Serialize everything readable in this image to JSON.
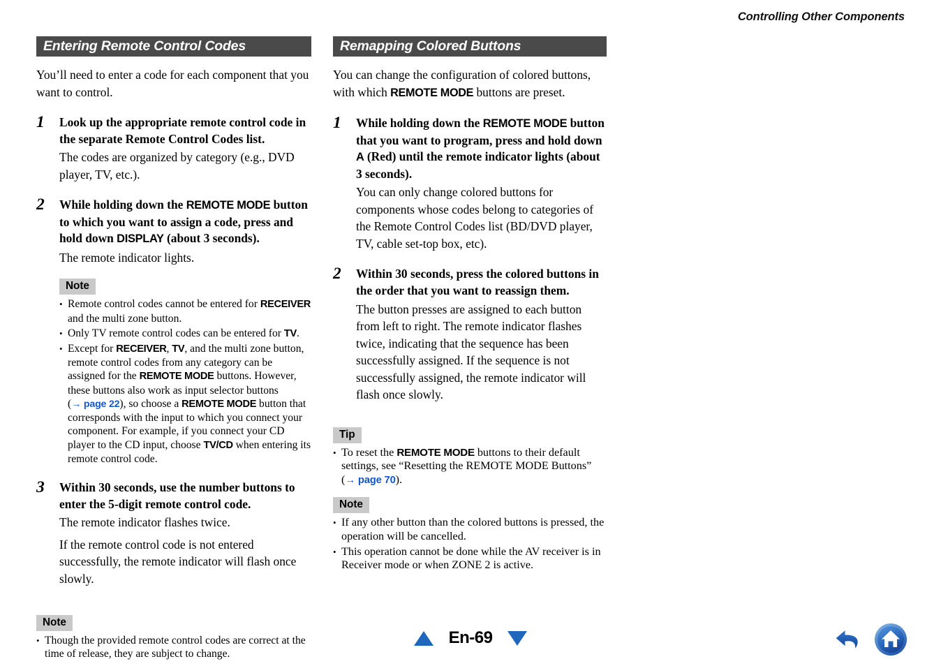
{
  "running_head": "Controlling Other Components",
  "colors": {
    "section_bar_bg": "#4a4a4a",
    "badge_bg": "#c9c9c9",
    "link_blue": "#1357cc",
    "nav_blue": "#1f66bd"
  },
  "left_column": {
    "section_title": "Entering Remote Control Codes",
    "intro": "You’ll need to enter a code for each component that you want to control.",
    "steps": [
      {
        "number": "1",
        "title_parts": [
          {
            "text": "Look up the appropriate remote control code in the separate Remote Control Codes list.",
            "style": "serif-bold"
          }
        ],
        "body": [
          "The codes are organized by category (e.g., DVD player, TV, etc.)."
        ]
      },
      {
        "number": "2",
        "title_parts": [
          {
            "text": "While holding down the ",
            "style": "serif-bold"
          },
          {
            "text": "REMOTE MODE",
            "style": "key"
          },
          {
            "text": " button to which you want to assign a code, press and hold down ",
            "style": "serif-bold"
          },
          {
            "text": "DISPLAY",
            "style": "key"
          },
          {
            "text": " (about 3 seconds).",
            "style": "serif-bold"
          }
        ],
        "body": [
          "The remote indicator lights."
        ],
        "note": {
          "badge": "Note",
          "bullets": [
            [
              {
                "text": "Remote control codes cannot be entered for ",
                "style": "serif"
              },
              {
                "text": "RECEIVER",
                "style": "key"
              },
              {
                "text": " and the multi zone button.",
                "style": "serif"
              }
            ],
            [
              {
                "text": "Only TV remote control codes can be entered for ",
                "style": "serif"
              },
              {
                "text": "TV",
                "style": "key"
              },
              {
                "text": ".",
                "style": "serif"
              }
            ],
            [
              {
                "text": "Except for ",
                "style": "serif"
              },
              {
                "text": "RECEIVER",
                "style": "key"
              },
              {
                "text": ", ",
                "style": "serif"
              },
              {
                "text": "TV",
                "style": "key"
              },
              {
                "text": ", and the multi zone button, remote control codes from any category can be assigned for the ",
                "style": "serif"
              },
              {
                "text": "REMOTE MODE",
                "style": "key"
              },
              {
                "text": " buttons. However, these buttons also work as input selector buttons (",
                "style": "serif"
              },
              {
                "text": "→ page 22",
                "style": "xref"
              },
              {
                "text": "), so choose a ",
                "style": "serif"
              },
              {
                "text": "REMOTE MODE",
                "style": "key"
              },
              {
                "text": " button that corresponds with the input to which you connect your component. For example, if you connect your CD player to the CD input, choose ",
                "style": "serif"
              },
              {
                "text": "TV/CD",
                "style": "key"
              },
              {
                "text": " when entering its remote control code.",
                "style": "serif"
              }
            ]
          ]
        }
      },
      {
        "number": "3",
        "title_parts": [
          {
            "text": "Within 30 seconds, use the number buttons to enter the 5-digit remote control code.",
            "style": "serif-bold"
          }
        ],
        "body": [
          "The remote indicator flashes twice.",
          "If the remote control code is not entered successfully, the remote indicator will flash once slowly."
        ]
      }
    ],
    "note": {
      "badge": "Note",
      "bullets": [
        [
          {
            "text": "Though the provided remote control codes are correct at the time of release, they are subject to change.",
            "style": "serif"
          }
        ]
      ]
    }
  },
  "right_column": {
    "section_title": "Remapping Colored Buttons",
    "intro_parts": [
      {
        "text": "You can change the configuration of colored buttons, with which ",
        "style": "serif"
      },
      {
        "text": "REMOTE MODE",
        "style": "key"
      },
      {
        "text": " buttons are preset.",
        "style": "serif"
      }
    ],
    "steps": [
      {
        "number": "1",
        "title_parts": [
          {
            "text": "While holding down the ",
            "style": "serif-bold"
          },
          {
            "text": "REMOTE MODE",
            "style": "key"
          },
          {
            "text": " button that you want to program, press and hold down ",
            "style": "serif-bold"
          },
          {
            "text": "A",
            "style": "key"
          },
          {
            "text": " (Red) until the remote indicator lights (about 3 seconds).",
            "style": "serif-bold"
          }
        ],
        "body": [
          "You can only change colored buttons for components whose codes belong to categories of the Remote Control Codes list (BD/DVD player, TV, cable set-top box, etc)."
        ]
      },
      {
        "number": "2",
        "title_parts": [
          {
            "text": "Within 30 seconds, press the colored buttons in the order that you want to reassign them.",
            "style": "serif-bold"
          }
        ],
        "body": [
          "The button presses are assigned to each button from left to right. The remote indicator flashes twice, indicating that the sequence has been successfully assigned. If the sequence is not successfully assigned, the remote indicator will flash once slowly."
        ]
      }
    ],
    "tip": {
      "badge": "Tip",
      "bullets": [
        [
          {
            "text": "To reset the ",
            "style": "serif"
          },
          {
            "text": "REMOTE MODE",
            "style": "key"
          },
          {
            "text": " buttons to their default settings, see “Resetting the REMOTE MODE Buttons” (",
            "style": "serif"
          },
          {
            "text": "→ page 70",
            "style": "xref"
          },
          {
            "text": ").",
            "style": "serif"
          }
        ]
      ]
    },
    "note": {
      "badge": "Note",
      "bullets": [
        [
          {
            "text": "If any other button than the colored buttons is pressed, the operation will be cancelled.",
            "style": "serif"
          }
        ],
        [
          {
            "text": "This operation cannot be done while the AV receiver is in Receiver mode or when ZONE 2 is active.",
            "style": "serif"
          }
        ]
      ]
    }
  },
  "footer": {
    "page_label": "En-69",
    "prev_icon": "triangle-up-icon",
    "next_icon": "triangle-down-icon",
    "back_icon": "back-arrow-icon",
    "home_icon": "home-icon"
  }
}
